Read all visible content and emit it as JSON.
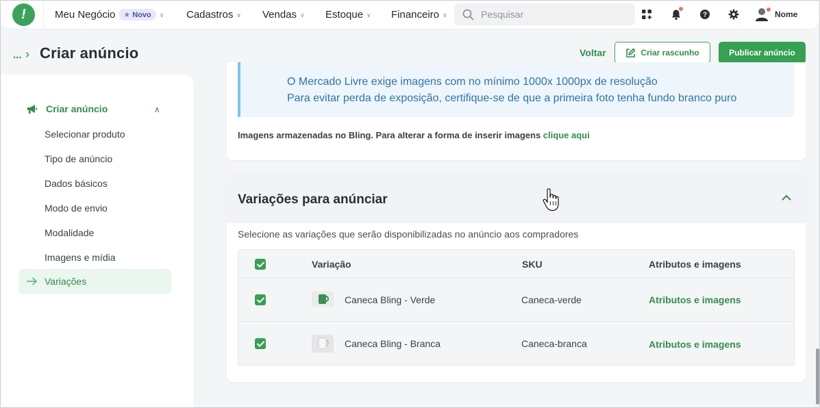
{
  "nav": {
    "business": "Meu Negócio",
    "badge": "Novo",
    "items": [
      "Cadastros",
      "Vendas",
      "Estoque",
      "Financeiro"
    ],
    "search_placeholder": "Pesquisar",
    "user_name": "Nome"
  },
  "header": {
    "breadcrumb_more": "...",
    "title": "Criar anúncio",
    "back_label": "Voltar",
    "draft_label": "Criar rascunho",
    "publish_label": "Publicar anúncio"
  },
  "sidebar": {
    "section_title": "Criar anúncio",
    "items": [
      "Selecionar produto",
      "Tipo de anúncio",
      "Dados básicos",
      "Modo de envio",
      "Modalidade",
      "Imagens e mídia"
    ],
    "active_item": "Variações"
  },
  "images_card": {
    "info_lines": [
      "O Mercado Livre exige imagens com no mínimo 1000x 1000px de resolução",
      "Para evitar perda de exposição, certifique-se de que a primeira foto tenha fundo branco puro"
    ],
    "storage_note": "Imagens armazenadas no Bling. Para alterar a forma de inserir imagens ",
    "storage_link": "clique aqui"
  },
  "variations": {
    "title": "Variações para anúnciar",
    "subtitle": "Selecione as variações que serão disponibilizadas no anúncio aos compradores",
    "columns": [
      "Variação",
      "SKU",
      "Atributos e imagens"
    ],
    "rows": [
      {
        "name": "Caneca Bling - Verde",
        "sku": "Caneca-verde",
        "action": "Atributos e imagens",
        "checked": true,
        "thumb_color": "#3a8f52"
      },
      {
        "name": "Caneca Bling - Branca",
        "sku": "Caneca-branca",
        "action": "Atributos e imagens",
        "checked": true,
        "thumb_color": "#d8dadc"
      }
    ]
  },
  "colors": {
    "brand_green": "#35a152",
    "info_blue": "#2e73ad"
  }
}
